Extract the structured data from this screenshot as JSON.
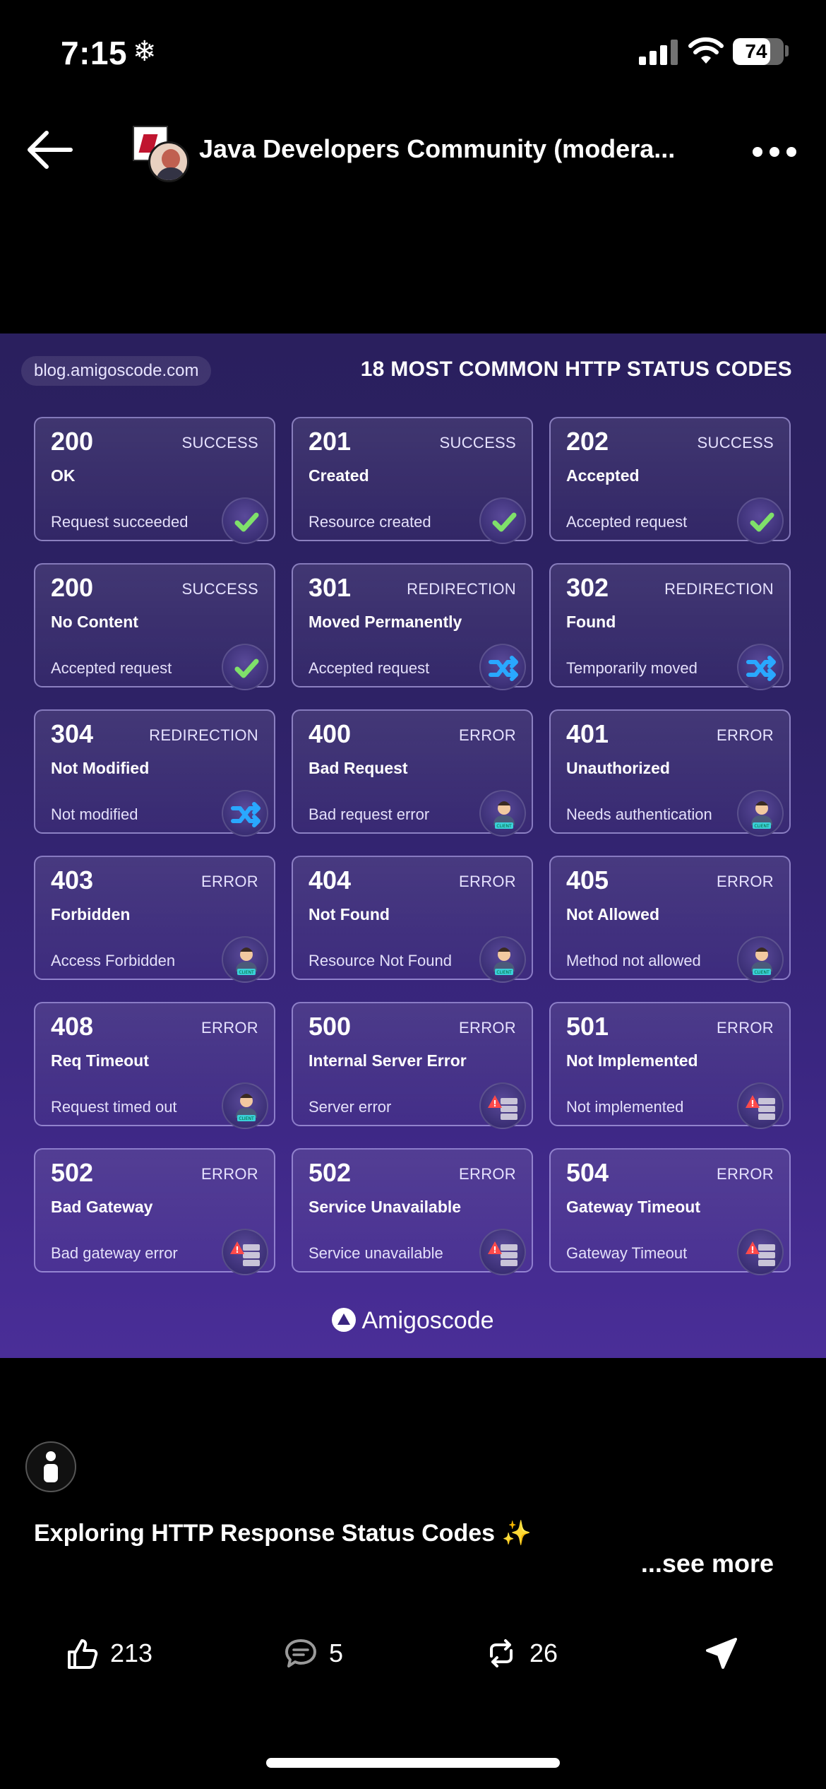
{
  "status_bar": {
    "time": "7:15",
    "battery": "74",
    "battery_level": 0.74
  },
  "nav": {
    "title": "Java Developers Community (modera..."
  },
  "image": {
    "site": "blog.amigoscode.com",
    "title": "18 MOST COMMON HTTP STATUS CODES",
    "brand": "Amigoscode",
    "cards": [
      {
        "code": "200",
        "category": "SUCCESS",
        "name": "OK",
        "desc": "Request succeeded",
        "icon": "check-icon"
      },
      {
        "code": "201",
        "category": "SUCCESS",
        "name": "Created",
        "desc": "Resource created",
        "icon": "check-icon"
      },
      {
        "code": "202",
        "category": "SUCCESS",
        "name": "Accepted",
        "desc": "Accepted request",
        "icon": "check-icon"
      },
      {
        "code": "200",
        "category": "SUCCESS",
        "name": "No Content",
        "desc": "Accepted request",
        "icon": "check-icon"
      },
      {
        "code": "301",
        "category": "REDIRECTION",
        "name": "Moved Permanently",
        "desc": "Accepted request",
        "icon": "shuffle-icon"
      },
      {
        "code": "302",
        "category": "REDIRECTION",
        "name": "Found",
        "desc": "Temporarily moved",
        "icon": "shuffle-icon"
      },
      {
        "code": "304",
        "category": "REDIRECTION",
        "name": "Not Modified",
        "desc": "Not modified",
        "icon": "shuffle-icon"
      },
      {
        "code": "400",
        "category": "ERROR",
        "name": "Bad Request",
        "desc": "Bad request error",
        "icon": "client-icon"
      },
      {
        "code": "401",
        "category": "ERROR",
        "name": "Unauthorized",
        "desc": "Needs authentication",
        "icon": "client-icon"
      },
      {
        "code": "403",
        "category": "ERROR",
        "name": "Forbidden",
        "desc": "Access Forbidden",
        "icon": "client-icon"
      },
      {
        "code": "404",
        "category": "ERROR",
        "name": "Not Found",
        "desc": "Resource Not Found",
        "icon": "client-icon"
      },
      {
        "code": "405",
        "category": "ERROR",
        "name": "Not Allowed",
        "desc": "Method not allowed",
        "icon": "client-icon"
      },
      {
        "code": "408",
        "category": "ERROR",
        "name": "Req Timeout",
        "desc": "Request timed out",
        "icon": "client-icon"
      },
      {
        "code": "500",
        "category": "ERROR",
        "name": "Internal Server Error",
        "desc": "Server error",
        "icon": "server-icon"
      },
      {
        "code": "501",
        "category": "ERROR",
        "name": "Not Implemented",
        "desc": "Not implemented",
        "icon": "server-icon"
      },
      {
        "code": "502",
        "category": "ERROR",
        "name": "Bad Gateway",
        "desc": "Bad gateway error",
        "icon": "server-icon"
      },
      {
        "code": "502",
        "category": "ERROR",
        "name": "Service Unavailable",
        "desc": "Service unavailable",
        "icon": "server-icon"
      },
      {
        "code": "504",
        "category": "ERROR",
        "name": "Gateway Timeout",
        "desc": "Gateway Timeout",
        "icon": "server-icon"
      }
    ]
  },
  "post": {
    "caption": "Exploring HTTP Response Status Codes ✨",
    "see_more": "...see more"
  },
  "actions": {
    "likes": "213",
    "comments": "5",
    "reposts": "26"
  },
  "colors": {
    "accent_check": "#7fe06a",
    "accent_shuffle": "#29a8ff",
    "background": "#000000",
    "card_bg": "#2e2266"
  }
}
